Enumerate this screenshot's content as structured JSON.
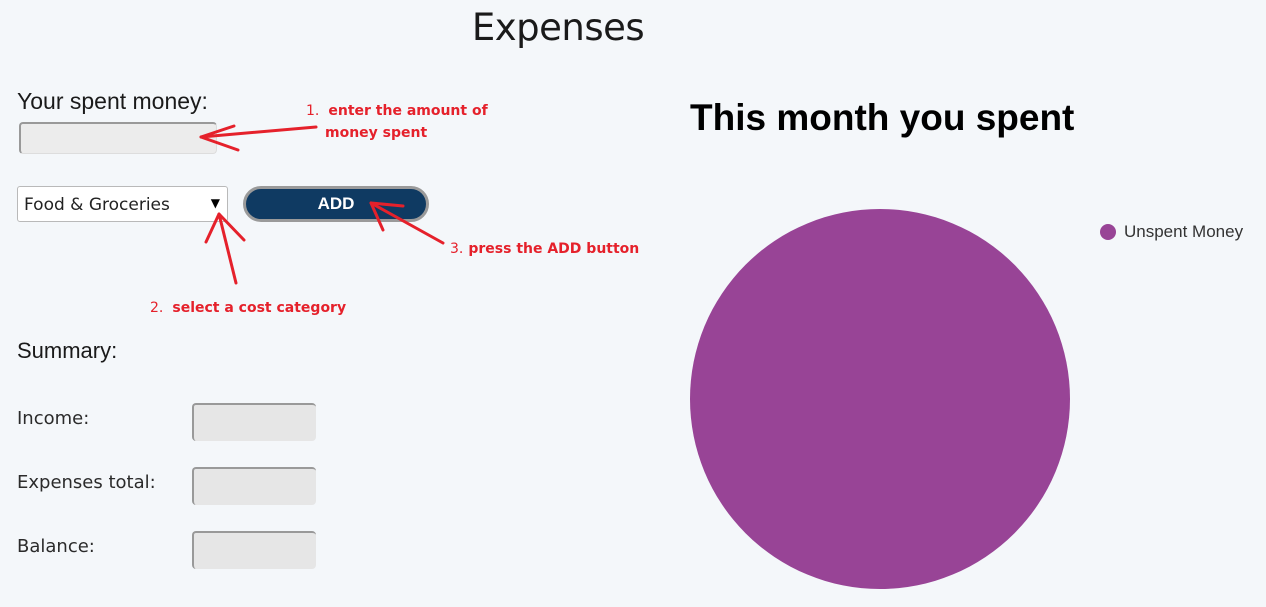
{
  "page": {
    "title": "Expenses"
  },
  "form": {
    "spent_label": "Your spent money:",
    "amount_value": "",
    "category_selected": "Food & Groceries",
    "add_label": "ADD"
  },
  "annotations": [
    {
      "num": "1.",
      "line1": "enter the amount of",
      "line2": "money spent"
    },
    {
      "num": "2.",
      "line1": "select a cost category"
    },
    {
      "num": "3.",
      "line1": "press the ADD button"
    }
  ],
  "summary": {
    "heading": "Summary:",
    "rows": [
      {
        "label": "Income:",
        "value": ""
      },
      {
        "label": "Expenses total:",
        "value": ""
      },
      {
        "label": "Balance:",
        "value": ""
      }
    ]
  },
  "chart_data": {
    "type": "pie",
    "title": "This month you spent",
    "legend_position": "top-right",
    "categories": [
      "Unspent Money"
    ],
    "values": [
      100
    ],
    "colors": [
      "#984496"
    ]
  },
  "colors": {
    "accent": "#0f3a62",
    "annotation": "#e5212b",
    "pie": "#984496"
  }
}
